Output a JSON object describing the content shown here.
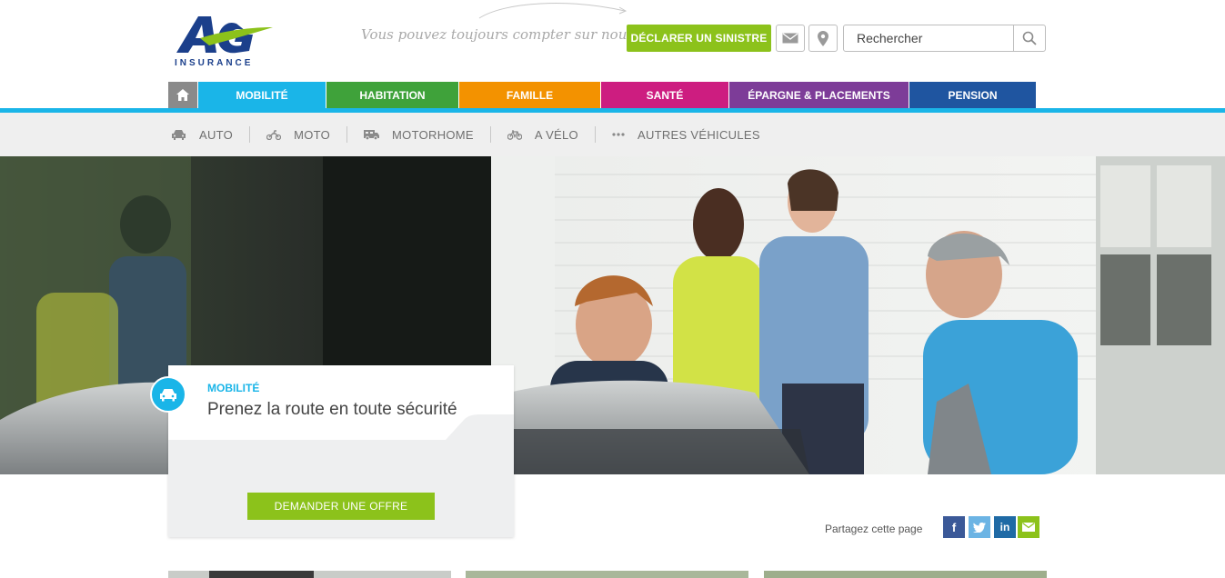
{
  "header": {
    "logo_text": "AG",
    "logo_subtitle": "INSURANCE",
    "tagline": "Vous pouvez toujours compter sur nous",
    "claim_button": "DÉCLARER UN SINISTRE",
    "search_placeholder": "Rechercher"
  },
  "mainnav": {
    "tabs": [
      {
        "label": "MOBILITÉ",
        "color": "#1ab5e8"
      },
      {
        "label": "HABITATION",
        "color": "#3fa23a"
      },
      {
        "label": "FAMILLE",
        "color": "#f39200"
      },
      {
        "label": "SANTÉ",
        "color": "#cd1d80"
      },
      {
        "label": "ÉPARGNE & PLACEMENTS",
        "color": "#7d3c98"
      },
      {
        "label": "PENSION",
        "color": "#1f55a0"
      }
    ]
  },
  "subnav": {
    "items": [
      {
        "label": "AUTO",
        "icon": "car-icon"
      },
      {
        "label": "MOTO",
        "icon": "motorbike-icon"
      },
      {
        "label": "MOTORHOME",
        "icon": "motorhome-icon"
      },
      {
        "label": "A VÉLO",
        "icon": "bicycle-icon"
      },
      {
        "label": "AUTRES VÉHICULES",
        "icon": "more-dots-icon"
      }
    ]
  },
  "card": {
    "category": "MOBILITÉ",
    "title": "Prenez la route en toute sécurité",
    "button": "DEMANDER UNE OFFRE"
  },
  "share": {
    "label": "Partagez cette page",
    "facebook": "f",
    "linkedin": "in",
    "colors": {
      "facebook": "#3b5998",
      "twitter": "#6cb4e4",
      "linkedin": "#1f6aa5",
      "email": "#8cc21b"
    }
  },
  "colors": {
    "accent_green": "#8cc21b",
    "accent_blue": "#1ab5e8",
    "brand_navy": "#1b3f8b"
  }
}
